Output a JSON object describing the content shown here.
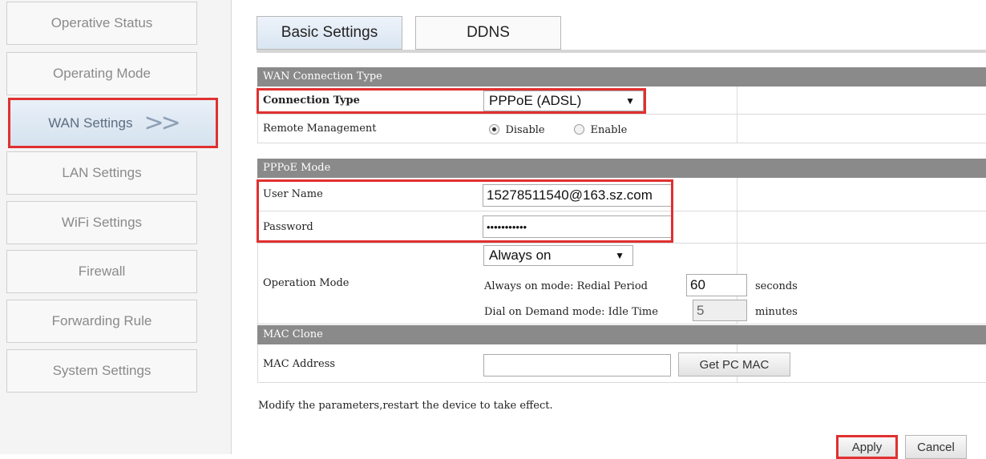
{
  "sidebar": {
    "items": [
      {
        "label": "Operative Status"
      },
      {
        "label": "Operating Mode"
      },
      {
        "label": "WAN Settings",
        "arrows": ">>"
      },
      {
        "label": "LAN Settings"
      },
      {
        "label": "WiFi Settings"
      },
      {
        "label": "Firewall"
      },
      {
        "label": "Forwarding Rule"
      },
      {
        "label": "System Settings"
      }
    ]
  },
  "tabs": [
    "Basic Settings",
    "DDNS"
  ],
  "wan": {
    "section_title": "WAN Connection Type",
    "connection_type_label": "Connection Type",
    "connection_type_value": "PPPoE (ADSL)",
    "remote_mgmt_label": "Remote Management",
    "remote_mgmt_options": [
      "Disable",
      "Enable"
    ],
    "remote_mgmt_selected": "Disable"
  },
  "pppoe": {
    "section_title": "PPPoE Mode",
    "username_label": "User Name",
    "username_value": "15278511540@163.sz.com",
    "password_label": "Password",
    "password_value": "•••••••••••",
    "operation_mode_label": "Operation Mode",
    "operation_mode_value": "Always on",
    "redial_label": "Always on mode: Redial Period",
    "redial_value": "60",
    "redial_unit": "seconds",
    "idle_label": "Dial on Demand mode: Idle Time",
    "idle_value": "5",
    "idle_unit": "minutes"
  },
  "mac": {
    "section_title": "MAC Clone",
    "address_label": "MAC Address",
    "address_value": "",
    "get_pc_mac_label": "Get PC MAC"
  },
  "note": "Modify the parameters,restart the device to take effect.",
  "actions": {
    "apply": "Apply",
    "cancel": "Cancel"
  },
  "colors": {
    "highlight": "#e03030",
    "section_header": "#8a8a8a",
    "active_nav": "#d5e2ef"
  }
}
